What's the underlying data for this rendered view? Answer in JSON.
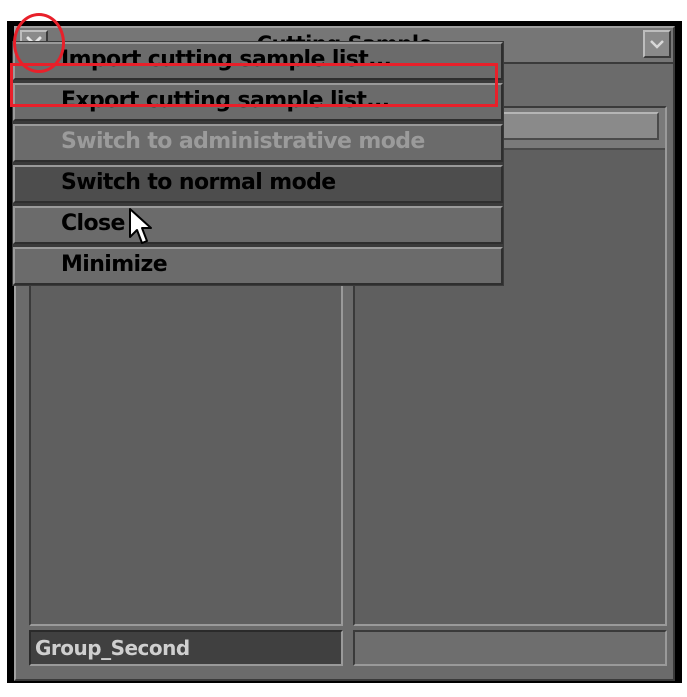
{
  "window": {
    "title": "Cutting Sample",
    "close_icon": "close-icon",
    "dropdown_icon": "chevron-down-icon"
  },
  "context_menu": {
    "items": [
      {
        "label": "Import cutting sample list...",
        "state": "normal"
      },
      {
        "label": "Export cutting sample list...",
        "state": "normal"
      },
      {
        "label": "Switch to administrative mode",
        "state": "disabled"
      },
      {
        "label": "Switch to normal mode",
        "state": "hovered"
      },
      {
        "label": "Close",
        "state": "normal"
      },
      {
        "label": "Minimize",
        "state": "normal"
      }
    ]
  },
  "footer": {
    "group_value": "Group_Second"
  },
  "annotations": {
    "highlight_color": "#e8202a"
  }
}
